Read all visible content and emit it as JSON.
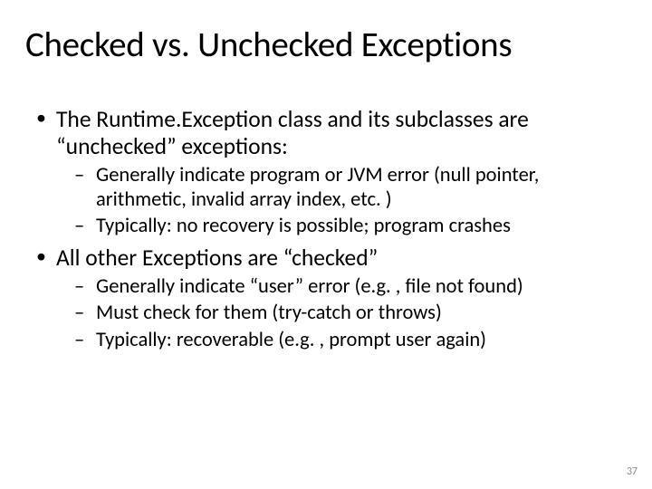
{
  "title": "Checked vs. Unchecked Exceptions",
  "bullets": {
    "b1": "The Runtime.Exception class and its subclasses are “unchecked” exceptions:",
    "b1_sub1": "Generally indicate program or JVM error (null pointer, arithmetic, invalid array index, etc. )",
    "b1_sub2": "Typically: no recovery is possible; program crashes",
    "b2": "All other Exceptions are “checked”",
    "b2_sub1": "Generally indicate “user” error (e.g. , file not found)",
    "b2_sub2": "Must check for them (try-catch or throws)",
    "b2_sub3": "Typically: recoverable (e.g. , prompt user again)"
  },
  "page_number": "37"
}
